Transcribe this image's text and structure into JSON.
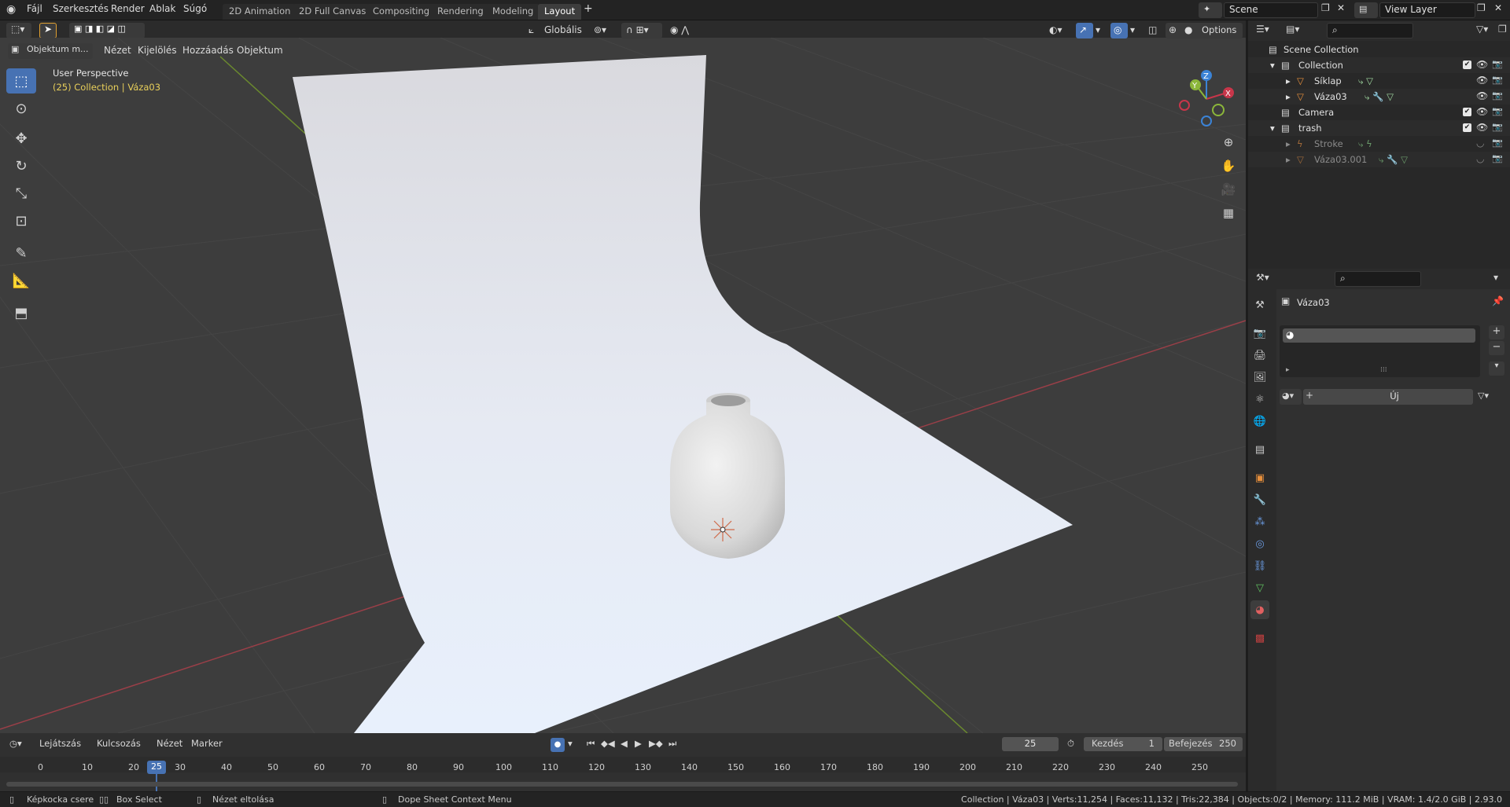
{
  "topbar": {
    "menus": [
      "Fájl",
      "Szerkesztés",
      "Render",
      "Ablak",
      "Súgó"
    ],
    "workspace_tabs": [
      "2D Animation",
      "2D Full Canvas",
      "Compositing",
      "Rendering",
      "Modeling",
      "Layout"
    ],
    "active_tab": "Layout",
    "add_tab": "+",
    "scene_name": "Scene",
    "view_layer": "View Layer"
  },
  "viewport_header": {
    "mode": "Objektum m...",
    "menus": [
      "Nézet",
      "Kijelölés",
      "Hozzáadás",
      "Objektum"
    ],
    "transform_orientation": "Globális",
    "options": "Options"
  },
  "viewport": {
    "perspective": "User Perspective",
    "collection_label": "(25) Collection | Váza03",
    "gizmo_axes": [
      "X",
      "Y",
      "Z"
    ]
  },
  "outliner": {
    "search_placeholder": "",
    "rows": [
      {
        "label": "Scene Collection",
        "indent": 0,
        "icon": "scene-collection-icon"
      },
      {
        "label": "Collection",
        "indent": 1,
        "icon": "collection-icon"
      },
      {
        "label": "Síklap",
        "indent": 2,
        "icon": "mesh-icon"
      },
      {
        "label": "Váza03",
        "indent": 2,
        "icon": "mesh-icon"
      },
      {
        "label": "Camera",
        "indent": 1,
        "icon": "collection-icon"
      },
      {
        "label": "trash",
        "indent": 1,
        "icon": "collection-icon"
      },
      {
        "label": "Stroke",
        "indent": 2,
        "icon": "gpencil-icon"
      },
      {
        "label": "Váza03.001",
        "indent": 2,
        "icon": "mesh-icon"
      }
    ]
  },
  "properties": {
    "object_name": "Váza03",
    "new_button": "Új"
  },
  "timeline": {
    "menus": [
      "Lejátszás",
      "Kulcsozás",
      "Nézet",
      "Marker"
    ],
    "current_frame": "25",
    "start_label": "Kezdés",
    "start_value": "1",
    "end_label": "Befejezés",
    "end_value": "250",
    "ticks": [
      "0",
      "10",
      "20",
      "25",
      "30",
      "40",
      "50",
      "60",
      "70",
      "80",
      "90",
      "100",
      "110",
      "120",
      "130",
      "140",
      "150",
      "160",
      "170",
      "180",
      "190",
      "200",
      "210",
      "220",
      "230",
      "240",
      "250"
    ]
  },
  "statusbar": {
    "left1": "Képkocka csere",
    "left2": "Box Select",
    "left3": "Nézet eltolása",
    "left4": "Dope Sheet Context Menu",
    "right": "Collection | Váza03 | Verts:11,254 | Faces:11,132 | Tris:22,384 | Objects:0/2 | Memory: 111.2 MiB | VRAM: 1.4/2.0 GiB | 2.93.0"
  },
  "colors": {
    "accent": "#4772b3",
    "x_axis": "#c8364a",
    "y_axis": "#8bb63a",
    "z_axis": "#3b83d6"
  }
}
